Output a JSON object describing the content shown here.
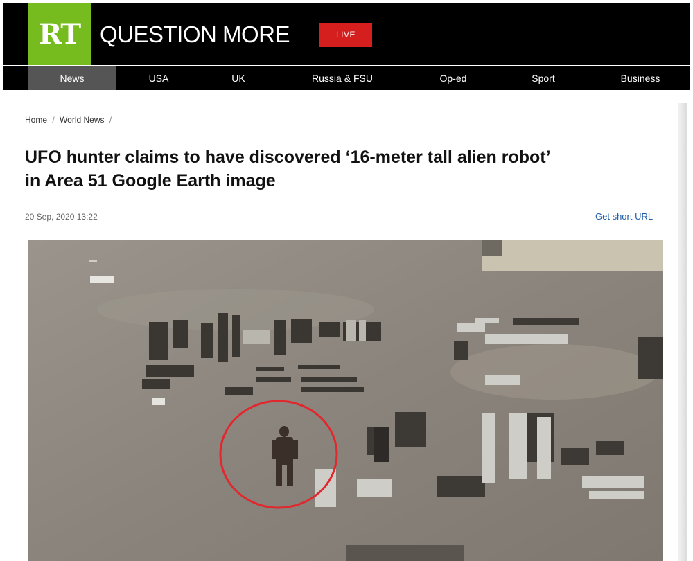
{
  "header": {
    "logo": "RT",
    "tagline": "QUESTION MORE",
    "live_label": "LIVE"
  },
  "nav": {
    "items": [
      {
        "label": "News",
        "active": true
      },
      {
        "label": "USA",
        "active": false
      },
      {
        "label": "UK",
        "active": false
      },
      {
        "label": "Russia & FSU",
        "active": false
      },
      {
        "label": "Op-ed",
        "active": false
      },
      {
        "label": "Sport",
        "active": false
      },
      {
        "label": "Business",
        "active": false
      }
    ]
  },
  "breadcrumb": {
    "home": "Home",
    "section": "World News",
    "separator": "/"
  },
  "article": {
    "title_line1": "UFO hunter claims to have discovered ‘16-meter tall alien robot’",
    "title_line2": "in Area 51 Google Earth image",
    "date": "20 Sep, 2020 13:22",
    "short_url_label": "Get short URL"
  },
  "colors": {
    "brand_green": "#77bc1f",
    "live_red": "#d51f1f",
    "circle_red": "#e0282e",
    "link_blue": "#1e5da8"
  }
}
